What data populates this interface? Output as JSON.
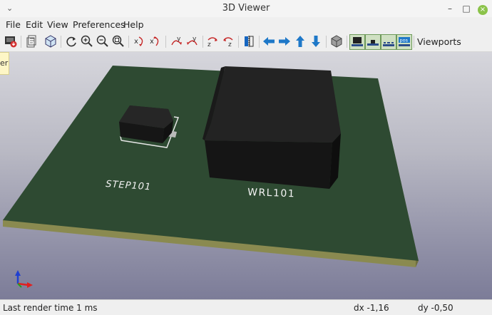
{
  "window": {
    "title": "3D Viewer",
    "left_control": "⌄"
  },
  "window_controls": {
    "minimize": "–",
    "maximize": "□",
    "close": "×"
  },
  "menu": {
    "items": [
      "File",
      "Edit",
      "View",
      "Preferences",
      "Help"
    ]
  },
  "toolbar": {
    "viewports_label": "Viewports",
    "icons": [
      "render-export-icon",
      "copy-icon",
      "3d-box-icon",
      "reload-icon",
      "zoom-in-icon",
      "zoom-out-icon",
      "zoom-fit-icon",
      "rotate-x-cw-icon",
      "rotate-x-ccw-icon",
      "rotate-y-cw-icon",
      "rotate-y-ccw-icon",
      "rotate-z-cw-icon",
      "rotate-z-ccw-icon",
      "flip-board-icon",
      "move-left-icon",
      "move-right-icon",
      "move-up-icon",
      "move-down-icon",
      "toggle-ortho-icon",
      "view-front-icon",
      "view-side-icon",
      "view-smd-icon",
      "view-pos-icon"
    ],
    "pos_badge": "pos"
  },
  "tooltip": {
    "text": "er"
  },
  "scene": {
    "board_color": "#2e4a32",
    "board_edge_color": "#8a8a50",
    "components": [
      {
        "reference": "STEP101"
      },
      {
        "reference": "WRL101"
      }
    ],
    "axis_colors": {
      "x": "#e02020",
      "y": "#20a020",
      "z": "#2040d0"
    }
  },
  "status": {
    "render_time": "Last render time 1 ms",
    "dx": "dx -1,16",
    "dy": "dy -0,50"
  }
}
